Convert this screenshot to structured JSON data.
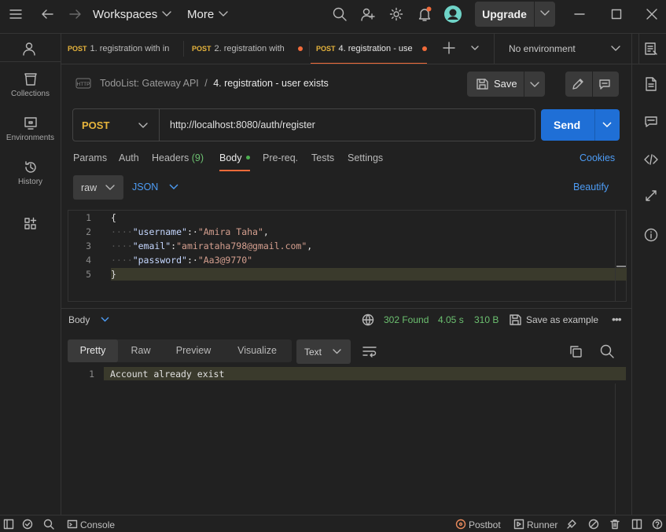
{
  "titlebar": {
    "workspaces": "Workspaces",
    "more": "More",
    "upgrade": "Upgrade"
  },
  "sidebar": {
    "items": [
      {
        "label": "Collections",
        "icon": "collections-icon"
      },
      {
        "label": "Environments",
        "icon": "environments-icon"
      },
      {
        "label": "History",
        "icon": "history-icon"
      },
      {
        "label": "",
        "icon": "apps-icon"
      }
    ]
  },
  "tabs": [
    {
      "method": "POST",
      "label": "1. registration with in"
    },
    {
      "method": "POST",
      "label": "2. registration with"
    },
    {
      "method": "POST",
      "label": "4. registration - use"
    }
  ],
  "environment": "No environment",
  "breadcrumb": {
    "collection": "TodoList: Gateway API",
    "separator": "/",
    "request": "4. registration - user exists"
  },
  "save_label": "Save",
  "request": {
    "method": "POST",
    "url": "http://localhost:8080/auth/register",
    "send_label": "Send"
  },
  "request_tabs": {
    "params": "Params",
    "auth": "Auth",
    "headers": "Headers",
    "headers_count": "(9)",
    "body": "Body",
    "prereq": "Pre-req.",
    "tests": "Tests",
    "settings": "Settings",
    "cookies": "Cookies"
  },
  "body_mode": {
    "raw": "raw",
    "json": "JSON",
    "beautify": "Beautify"
  },
  "code_lines": {
    "n1": "1",
    "n2": "2",
    "n3": "3",
    "n4": "4",
    "n5": "5",
    "l1": "{",
    "k2": "\"username\"",
    "v2": "\"Amira Taha\"",
    "k3": "\"email\"",
    "v3": "\"amirataha798@gmail.com\"",
    "k4": "\"password\"",
    "v4": "\"Aa3@9770\"",
    "l5": "}"
  },
  "response": {
    "body_label": "Body",
    "status": "302 Found",
    "time": "4.05 s",
    "size": "310 B",
    "save_example": "Save as example",
    "tabs": [
      "Pretty",
      "Raw",
      "Preview",
      "Visualize"
    ],
    "format": "Text",
    "line_no": "1",
    "line": "Account already exist"
  },
  "statusbar": {
    "console": "Console",
    "postbot": "Postbot",
    "runner": "Runner"
  }
}
